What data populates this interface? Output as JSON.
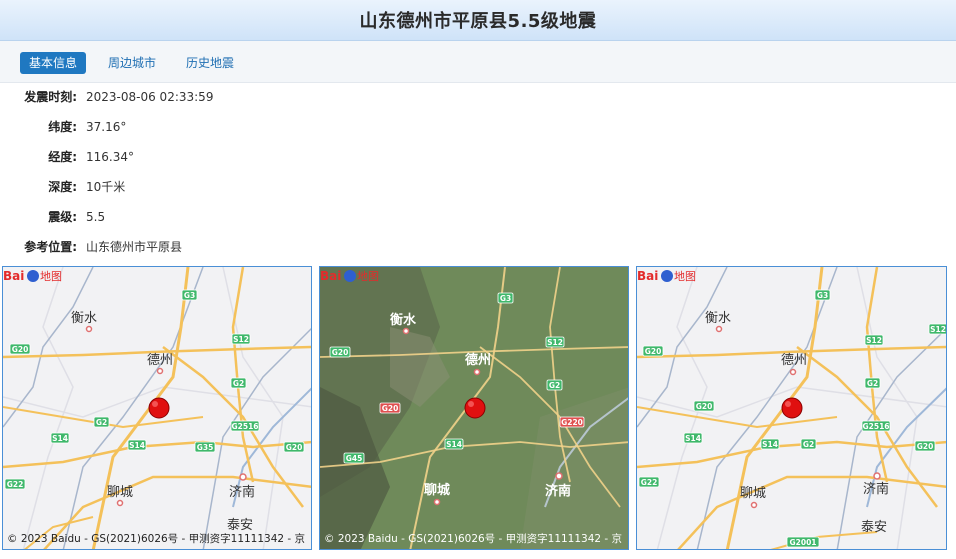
{
  "title": "山东德州市平原县5.5级地震",
  "tabs": [
    {
      "label": "基本信息",
      "active": true
    },
    {
      "label": "周边城市",
      "active": false
    },
    {
      "label": "历史地震",
      "active": false
    }
  ],
  "info": [
    {
      "label": "发震时刻:",
      "value": "2023-08-06 02:33:59"
    },
    {
      "label": "纬度:",
      "value": "37.16°"
    },
    {
      "label": "经度:",
      "value": "116.34°"
    },
    {
      "label": "深度:",
      "value": "10千米"
    },
    {
      "label": "震级:",
      "value": "5.5"
    },
    {
      "label": "参考位置:",
      "value": "山东德州市平原县"
    }
  ],
  "maps": {
    "copyright": "© 2023 Baidu - GS(2021)6026号 - 甲测资字11111342 - 京",
    "logo_text": "Baidu地图",
    "cities": {
      "hengshui": "衡水",
      "dezhou": "德州",
      "liaocheng": "聊城",
      "jinan": "济南",
      "taian": "泰安"
    },
    "roads": {
      "g3": "G3",
      "g20": "G20",
      "s12": "S12",
      "g2": "G2",
      "g2516": "G2516",
      "s14": "S14",
      "g35": "G35",
      "g22": "G22",
      "g45": "G45",
      "g220": "G220",
      "g2001": "G2001"
    },
    "epicenter_color": "#e01010",
    "tile_color": "#f2f2f4",
    "satellite_color": "#6f8a5a"
  }
}
